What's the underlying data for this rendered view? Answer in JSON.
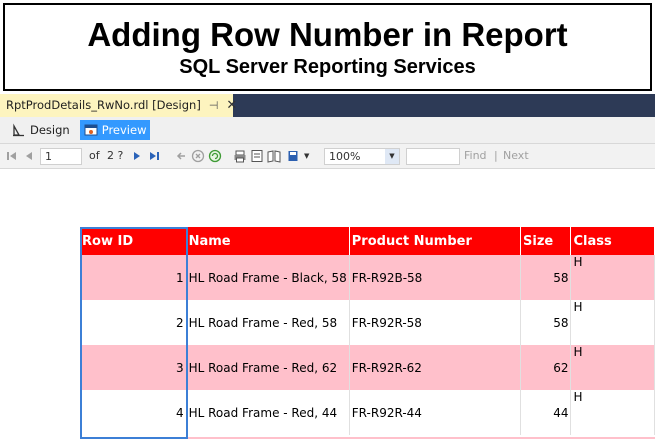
{
  "banner": {
    "title": "Adding Row Number in Report",
    "subtitle": "SQL Server Reporting Services"
  },
  "document_tab": {
    "label": "RptProdDetails_RwNo.rdl [Design]",
    "pin_icon": "pin-icon",
    "close_icon": "close-icon"
  },
  "view_toolbar": {
    "design_label": "Design",
    "preview_label": "Preview",
    "active_view": "Preview"
  },
  "report_toolbar": {
    "page_value": "1",
    "of_label": "of",
    "total_pages": "2 ?",
    "zoom_value": "100%",
    "find_label": "Find",
    "separator": "|",
    "next_label": "Next",
    "icons": [
      "first-page-icon",
      "previous-page-icon",
      "next-page-icon",
      "last-page-icon",
      "back-icon",
      "stop-icon",
      "refresh-icon",
      "print-icon",
      "print-layout-icon",
      "page-setup-icon",
      "export-icon"
    ]
  },
  "report": {
    "headers": [
      "Row ID",
      "Name",
      "Product Number",
      "Size",
      "Class"
    ],
    "rows": [
      {
        "row_id": "1",
        "name": "HL Road Frame - Black, 58",
        "product_number": "FR-R92B-58",
        "size": "58",
        "class": "H"
      },
      {
        "row_id": "2",
        "name": "HL Road Frame - Red, 58",
        "product_number": "FR-R92R-58",
        "size": "58",
        "class": "H"
      },
      {
        "row_id": "3",
        "name": "HL Road Frame - Red, 62",
        "product_number": "FR-R92R-62",
        "size": "62",
        "class": "H"
      },
      {
        "row_id": "4",
        "name": "HL Road Frame - Red, 44",
        "product_number": "FR-R92R-44",
        "size": "44",
        "class": "H"
      }
    ]
  },
  "colors": {
    "header_bg": "#ff0000",
    "alt_row_bg": "#ffc0cb",
    "tab_bg": "#fdf4bf",
    "tabstrip_bg": "#2d3a56",
    "preview_active": "#3399ff",
    "selection": "#3c7fd6"
  }
}
